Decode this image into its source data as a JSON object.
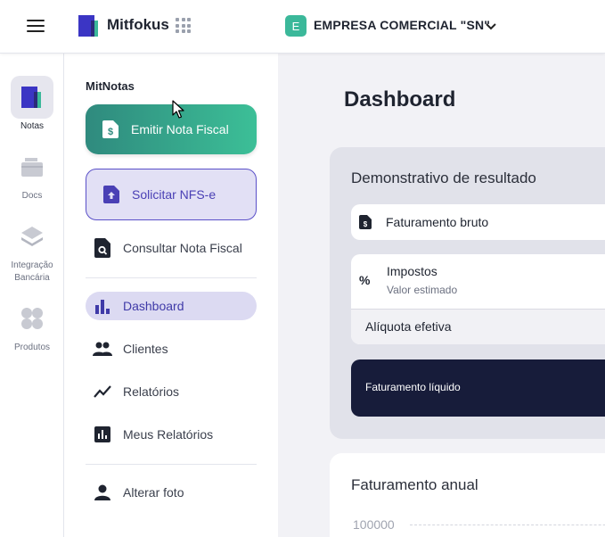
{
  "header": {
    "brand_name": "Mitfokus",
    "company_initial": "E",
    "company_name": "EMPRESA COMERCIAL \"SN\"",
    "accent_color": "#3bb89a"
  },
  "rail": {
    "items": [
      {
        "label": "Notas",
        "icon": "notas-icon",
        "active": true
      },
      {
        "label": "Docs",
        "icon": "docs-icon",
        "active": false
      },
      {
        "label": "Integração Bancária",
        "icon": "layers-icon",
        "active": false
      },
      {
        "label": "Produtos",
        "icon": "products-icon",
        "active": false
      }
    ]
  },
  "menu": {
    "title": "MitNotas",
    "emit_label": "Emitir Nota Fiscal",
    "solicit_label": "Solicitar NFS-e",
    "consult_label": "Consultar Nota Fiscal",
    "items": [
      {
        "label": "Dashboard",
        "icon": "bar-chart-icon",
        "active": true
      },
      {
        "label": "Clientes",
        "icon": "people-icon",
        "active": false
      },
      {
        "label": "Relatórios",
        "icon": "trend-icon",
        "active": false
      },
      {
        "label": "Meus Relatórios",
        "icon": "report-icon",
        "active": false
      }
    ],
    "photo_label": "Alterar foto"
  },
  "main": {
    "page_title": "Dashboard",
    "demo": {
      "title": "Demonstrativo de resultado",
      "gross_label": "Faturamento bruto",
      "taxes_symbol": "%",
      "taxes_label": "Impostos",
      "taxes_sub": "Valor estimado",
      "rate_label": "Alíquota efetiva",
      "net_label": "Faturamento líquido"
    },
    "annual": {
      "title": "Faturamento anual",
      "tick_top": "100000"
    }
  }
}
